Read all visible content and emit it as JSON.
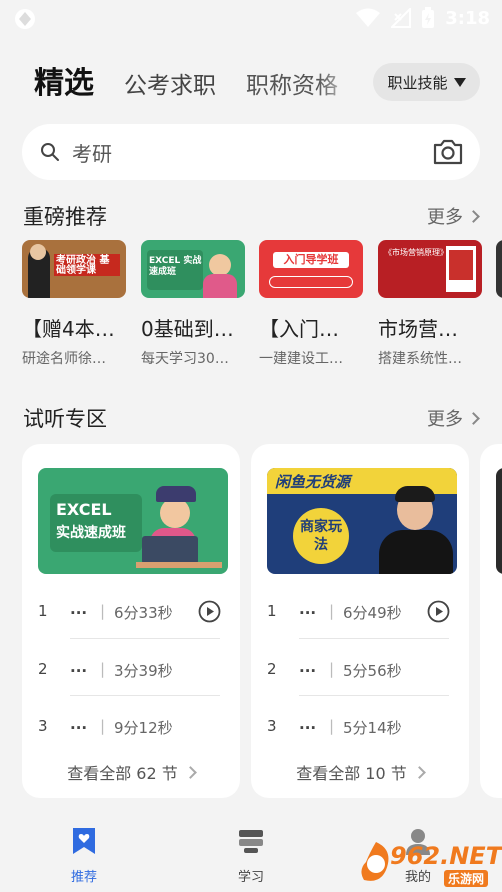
{
  "status_bar": {
    "time": "3:18"
  },
  "tabs": {
    "active": "精选",
    "items": [
      "公考求职",
      "职称资格"
    ],
    "dropdown_label": "职业技能"
  },
  "search": {
    "placeholder": "考研"
  },
  "recommend": {
    "title": "重磅推荐",
    "more": "更多",
    "items": [
      {
        "title": "【赠4本…",
        "subtitle": "研途名师徐…",
        "thumb_text": "考研政治 基础领学课"
      },
      {
        "title": "0基础到…",
        "subtitle": "每天学习30…",
        "thumb_text": "EXCEL 实战速成班"
      },
      {
        "title": "【入门…",
        "subtitle": "一建建设工…",
        "thumb_text": "入门导学班"
      },
      {
        "title": "市场营…",
        "subtitle": "搭建系统性…",
        "thumb_text": "《市场营销原理》"
      }
    ]
  },
  "audition": {
    "title": "试听专区",
    "more": "更多",
    "cards": [
      {
        "image_text_1": "EXCEL",
        "image_text_2": "实战速成班",
        "lessons": [
          {
            "num": "1",
            "title": "...",
            "duration": "6分33秒"
          },
          {
            "num": "2",
            "title": "...",
            "duration": "3分39秒"
          },
          {
            "num": "3",
            "title": "...",
            "duration": "9分12秒"
          }
        ],
        "view_all": "查看全部 62 节"
      },
      {
        "image_text_1": "闲鱼无货源",
        "image_text_2": "商家玩法",
        "lessons": [
          {
            "num": "1",
            "title": "...",
            "duration": "6分49秒"
          },
          {
            "num": "2",
            "title": "...",
            "duration": "5分56秒"
          },
          {
            "num": "3",
            "title": "...",
            "duration": "5分14秒"
          }
        ],
        "view_all": "查看全部 10 节"
      }
    ]
  },
  "bottom_nav": {
    "items": [
      {
        "label": "推荐",
        "active": true
      },
      {
        "label": "学习",
        "active": false
      },
      {
        "label": "我的",
        "active": false
      }
    ]
  },
  "watermark": {
    "text": "962.NET",
    "sub": "乐游网"
  },
  "colors": {
    "accent_blue": "#2f6be0",
    "red_thumb": "#e03a3a",
    "green_thumb": "#34a36b",
    "dark_red_thumb": "#b81f24"
  }
}
